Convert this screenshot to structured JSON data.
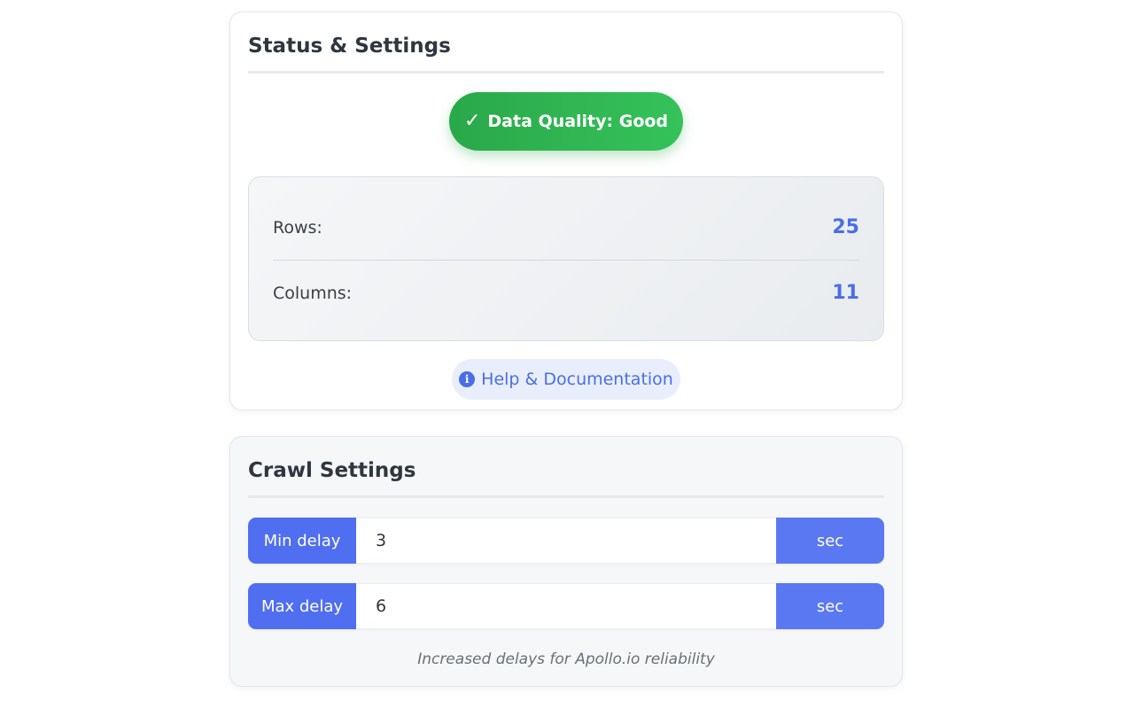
{
  "status_card": {
    "title": "Status & Settings",
    "quality_badge": {
      "icon": "check-icon",
      "check_glyph": "✓",
      "label": "Data Quality: Good",
      "color": "#28a745"
    },
    "stats": [
      {
        "label": "Rows:",
        "value": "25"
      },
      {
        "label": "Columns:",
        "value": "11"
      }
    ],
    "help_button": {
      "icon": "info-icon",
      "icon_glyph": "i",
      "label": "Help & Documentation"
    }
  },
  "crawl_card": {
    "title": "Crawl Settings",
    "fields": [
      {
        "label": "Min delay",
        "value": "3",
        "unit": "sec"
      },
      {
        "label": "Max delay",
        "value": "6",
        "unit": "sec"
      }
    ],
    "note": "Increased delays for Apollo.io reliability"
  },
  "colors": {
    "accent": "#4f6ef0",
    "stat_value": "#4a6ee8",
    "success": "#28a745"
  }
}
